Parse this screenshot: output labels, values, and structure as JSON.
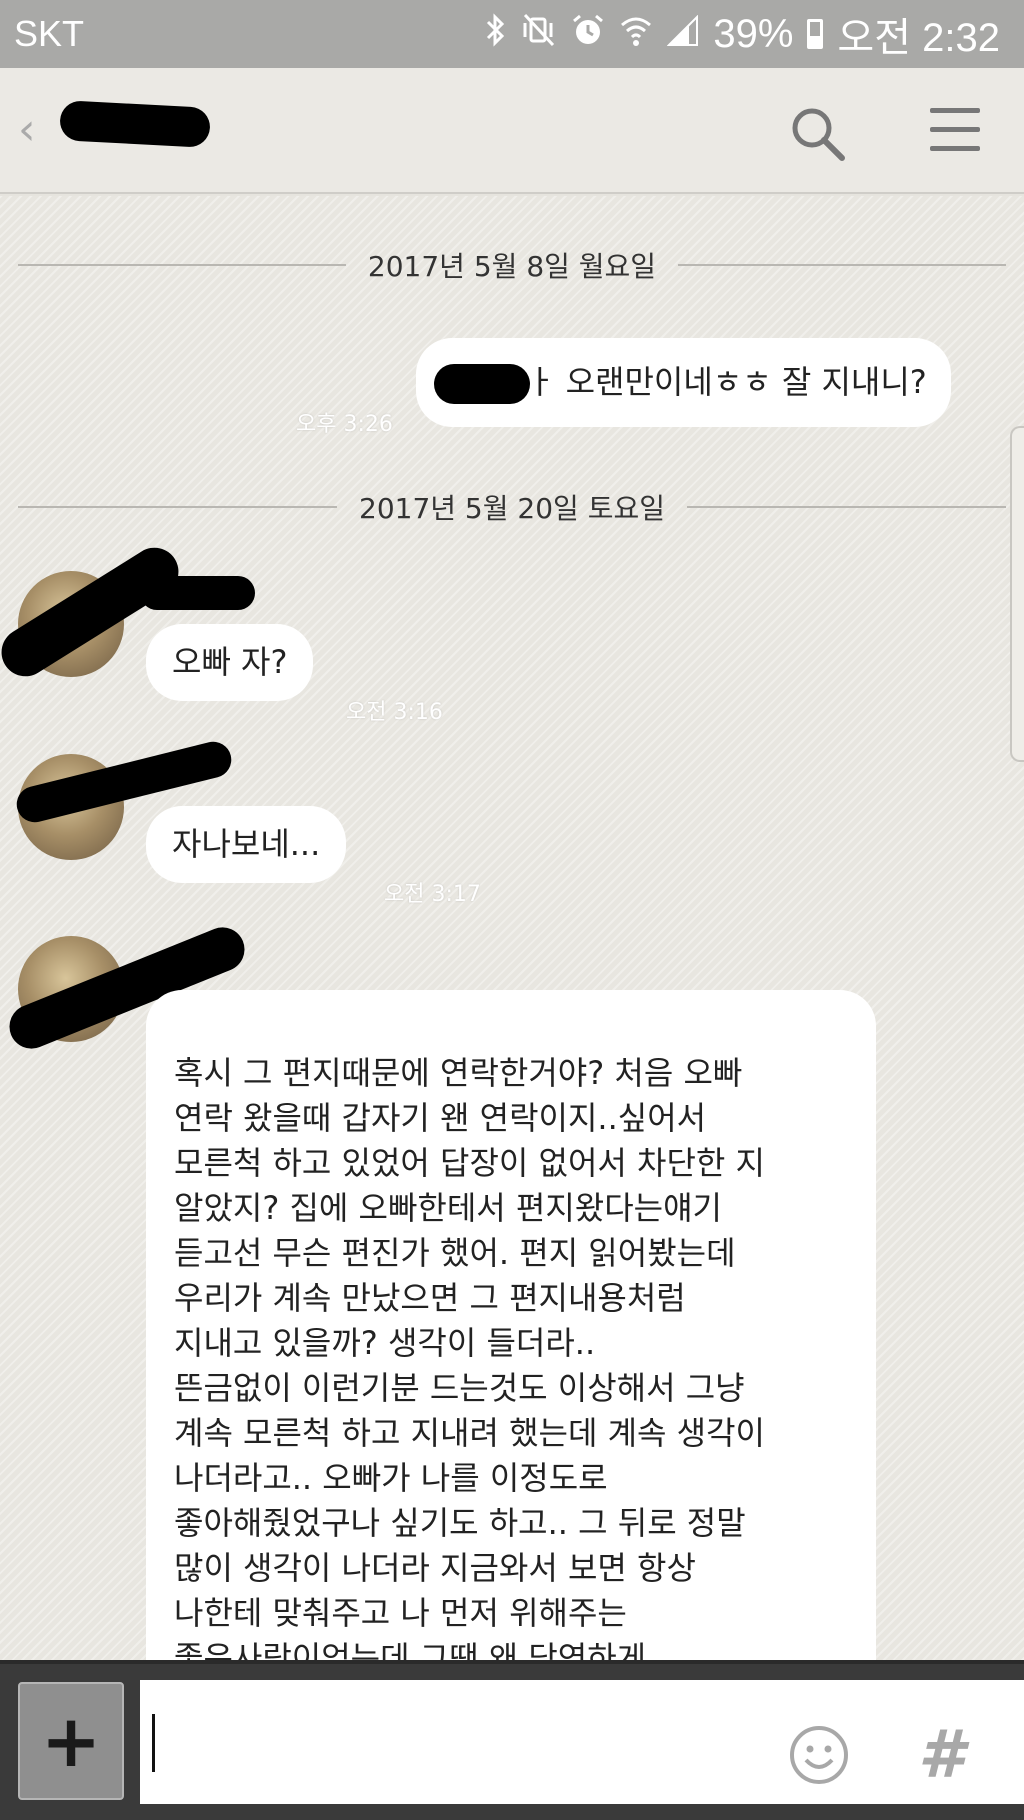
{
  "status_bar": {
    "carrier": "SKT",
    "battery": "39%",
    "time": "오전 2:32"
  },
  "header": {
    "back_icon": "chevron-left-icon",
    "search_icon": "search-icon",
    "menu_icon": "menu-icon"
  },
  "chat": {
    "dates": [
      "2017년 5월 8일 월요일",
      "2017년 5월 20일 토요일"
    ],
    "messages": [
      {
        "from": "me",
        "text": "ㅏ 오랜만이네ㅎㅎ 잘 지내니?",
        "time": "오후 3:26"
      },
      {
        "from": "other",
        "text": "오빠 자?",
        "time": "오전 3:16"
      },
      {
        "from": "other",
        "text": "자나보네...",
        "time": "오전 3:17"
      },
      {
        "from": "other",
        "text": "혹시 그 편지때문에 연락한거야? 처음 오빠\n연락 왔을때 갑자기 왠 연락이지..싶어서\n모른척 하고 있었어 답장이 없어서 차단한 지\n알았지? 집에 오빠한테서 편지왔다는얘기\n듣고선 무슨 편진가 했어. 편지 읽어봤는데\n우리가 계속 만났으면 그 편지내용처럼\n지내고 있을까? 생각이 들더라..\n뜬금없이 이런기분 드는것도 이상해서 그냥\n계속 모른척 하고 지내려 했는데 계속 생각이\n나더라고.. 오빠가 나를 이정도로\n좋아해줬었구나 싶기도 하고.. 그 뒤로 정말\n많이 생각이 나더라 지금와서 보면 항상\n나한테 맞춰주고 나 먼저 위해주는\n좋은사람이었는데 그땐 왜 당연하게\n생각하고 몰랐을까? 난사 오빠랑",
        "time": ""
      }
    ]
  },
  "input_bar": {
    "plus_label": "+",
    "placeholder": "",
    "hash_label": "#",
    "emoji_icon": "emoji-icon"
  }
}
